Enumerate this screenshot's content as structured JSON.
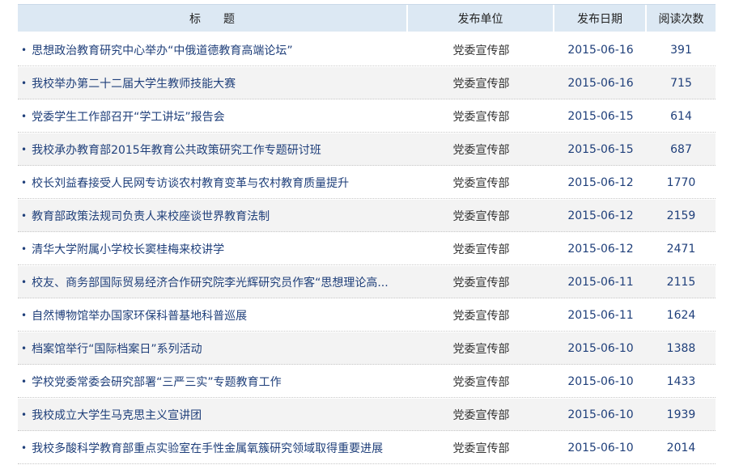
{
  "headers": {
    "title": "标　　题",
    "unit": "发布单位",
    "date": "发布日期",
    "views": "阅读次数"
  },
  "bullet": "•",
  "rows": [
    {
      "title": "思想政治教育研究中心举办“中俄道德教育高端论坛”",
      "unit": "党委宣传部",
      "date": "2015-06-16",
      "views": "391"
    },
    {
      "title": "我校举办第二十二届大学生教师技能大赛",
      "unit": "党委宣传部",
      "date": "2015-06-16",
      "views": "715"
    },
    {
      "title": "党委学生工作部召开“学工讲坛”报告会",
      "unit": "党委宣传部",
      "date": "2015-06-15",
      "views": "614"
    },
    {
      "title": "我校承办教育部2015年教育公共政策研究工作专题研讨班",
      "unit": "党委宣传部",
      "date": "2015-06-15",
      "views": "687"
    },
    {
      "title": "校长刘益春接受人民网专访谈农村教育变革与农村教育质量提升",
      "unit": "党委宣传部",
      "date": "2015-06-12",
      "views": "1770"
    },
    {
      "title": "教育部政策法规司负责人来校座谈世界教育法制",
      "unit": "党委宣传部",
      "date": "2015-06-12",
      "views": "2159"
    },
    {
      "title": "清华大学附属小学校长窦桂梅来校讲学",
      "unit": "党委宣传部",
      "date": "2015-06-12",
      "views": "2471"
    },
    {
      "title": "校友、商务部国际贸易经济合作研究院李光辉研究员作客“思想理论高...",
      "unit": "党委宣传部",
      "date": "2015-06-11",
      "views": "2115"
    },
    {
      "title": "自然博物馆举办国家环保科普基地科普巡展",
      "unit": "党委宣传部",
      "date": "2015-06-11",
      "views": "1624"
    },
    {
      "title": "档案馆举行“国际档案日”系列活动",
      "unit": "党委宣传部",
      "date": "2015-06-10",
      "views": "1388"
    },
    {
      "title": "学校党委常委会研究部署“三严三实”专题教育工作",
      "unit": "党委宣传部",
      "date": "2015-06-10",
      "views": "1433"
    },
    {
      "title": "我校成立大学生马克思主义宣讲团",
      "unit": "党委宣传部",
      "date": "2015-06-10",
      "views": "1939"
    },
    {
      "title": "我校多酸科学教育部重点实验室在手性金属氧簇研究领域取得重要进展",
      "unit": "党委宣传部",
      "date": "2015-06-10",
      "views": "2014"
    }
  ]
}
